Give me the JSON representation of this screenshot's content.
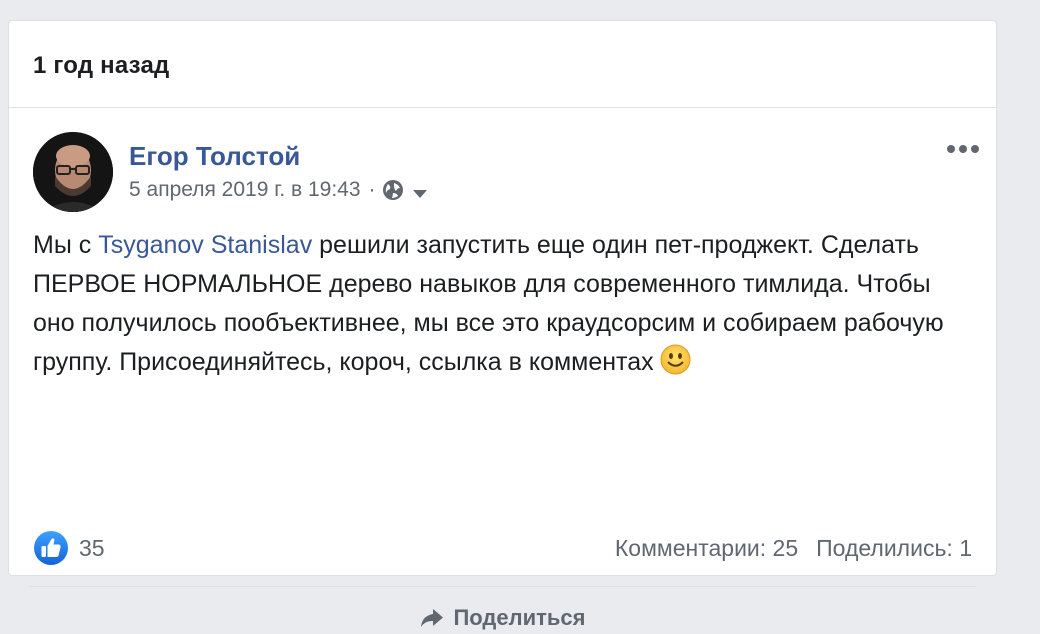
{
  "header": {
    "title": "1 год назад"
  },
  "post": {
    "author": "Егор Толстой",
    "timestamp": "5 апреля 2019 г. в 19:43",
    "separator": "·",
    "privacy_icon": "globe-icon",
    "text": {
      "before_mention": "Мы с ",
      "mention": "Tsyganov Stanislav",
      "after_mention": " решили запустить еще один пет-проджект. Сделать ПЕРВОЕ НОРМАЛЬНОЕ дерево навыков для современного тимлида. Чтобы оно получилось пообъективнее, мы все это краудсорсим и собираем рабочую группу. Присоединяйтесь, короч, ссылка в комментах",
      "emoji": "smile-emoji"
    },
    "reactions": {
      "count": "35",
      "icon": "like-icon"
    },
    "comments": "Комментарии: 25",
    "shares": "Поделились: 1",
    "share_button": "Поделиться"
  },
  "colors": {
    "link": "#385898",
    "text": "#1c1e21",
    "secondary": "#606770",
    "like_blue": "#1877f2"
  }
}
